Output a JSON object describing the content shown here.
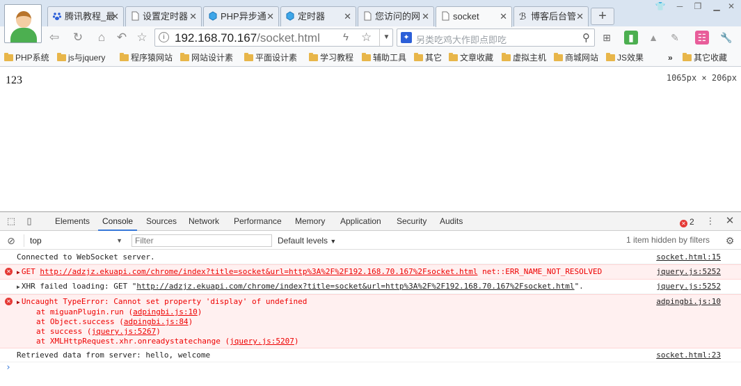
{
  "tabs": [
    {
      "label": "腾讯教程_最",
      "icon": "paw-icon",
      "active": false
    },
    {
      "label": "设置定时器",
      "icon": "page-icon",
      "active": false
    },
    {
      "label": "PHP异步通",
      "icon": "gem-icon",
      "active": false
    },
    {
      "label": "定时器",
      "icon": "gem-icon",
      "active": false
    },
    {
      "label": "您访问的网",
      "icon": "page-icon",
      "active": false
    },
    {
      "label": "socket",
      "icon": "page-icon",
      "active": true
    },
    {
      "label": "博客后台管",
      "icon": "blog-icon",
      "active": false
    }
  ],
  "toolbar": {
    "url_host": "192.168.70.167",
    "url_path": "/socket.html",
    "search_placeholder": "另类吃鸡大作即点即吃"
  },
  "bookmarks": [
    {
      "label": "PHP系统"
    },
    {
      "label": "js与jquery"
    },
    {
      "label": "程序猿网站"
    },
    {
      "label": "网站设计素"
    },
    {
      "label": "平面设计素"
    },
    {
      "label": "学习教程"
    },
    {
      "label": "辅助工具"
    },
    {
      "label": "其它"
    },
    {
      "label": "文章收藏"
    },
    {
      "label": "虚拟主机"
    },
    {
      "label": "商城网站"
    },
    {
      "label": "JS效果"
    }
  ],
  "bookmarks_more": "»",
  "bookmarks_other": "其它收藏",
  "page": {
    "content": "123",
    "dimensions": "1065px × 206px"
  },
  "devtools": {
    "tabs": [
      "Elements",
      "Console",
      "Sources",
      "Network",
      "Performance",
      "Memory",
      "Application",
      "Security",
      "Audits"
    ],
    "active_tab": "Console",
    "error_count": "2",
    "context": "top",
    "filter_placeholder": "Filter",
    "levels": "Default levels",
    "hidden_note": "1 item hidden by filters",
    "messages": [
      {
        "type": "log",
        "text": "Connected to WebSocket server.",
        "source": "socket.html:15"
      },
      {
        "type": "error",
        "prefix": "GET ",
        "link": "http://adzjz.ekuapi.com/chrome/index?title=socket&url=http%3A%2F%2F192.168.70.167%2Fsocket.html",
        "suffix": " net::ERR_NAME_NOT_RESOLVED",
        "source": "jquery.js:5252"
      },
      {
        "type": "xhr",
        "prefix": "XHR failed loading: GET \"",
        "link": "http://adzjz.ekuapi.com/chrome/index?title=socket&url=http%3A%2F%2F192.168.70.167%2Fsocket.html",
        "suffix": "\".",
        "source": "jquery.js:5252"
      },
      {
        "type": "error",
        "text": "Uncaught TypeError: Cannot set property 'display' of undefined",
        "source": "adpingbi.js:10",
        "stack": [
          {
            "fn": "at miguanPlugin.run (",
            "loc": "adpingbi.js:10",
            "end": ")"
          },
          {
            "fn": "at Object.success (",
            "loc": "adpingbi.js:84",
            "end": ")"
          },
          {
            "fn": "at success (",
            "loc": "jquery.js:5267",
            "end": ")"
          },
          {
            "fn": "at XMLHttpRequest.xhr.onreadystatechange (",
            "loc": "jquery.js:5207",
            "end": ")"
          }
        ]
      },
      {
        "type": "log",
        "text": "Retrieved data from server: hello, welcome",
        "source": "socket.html:23"
      }
    ]
  }
}
